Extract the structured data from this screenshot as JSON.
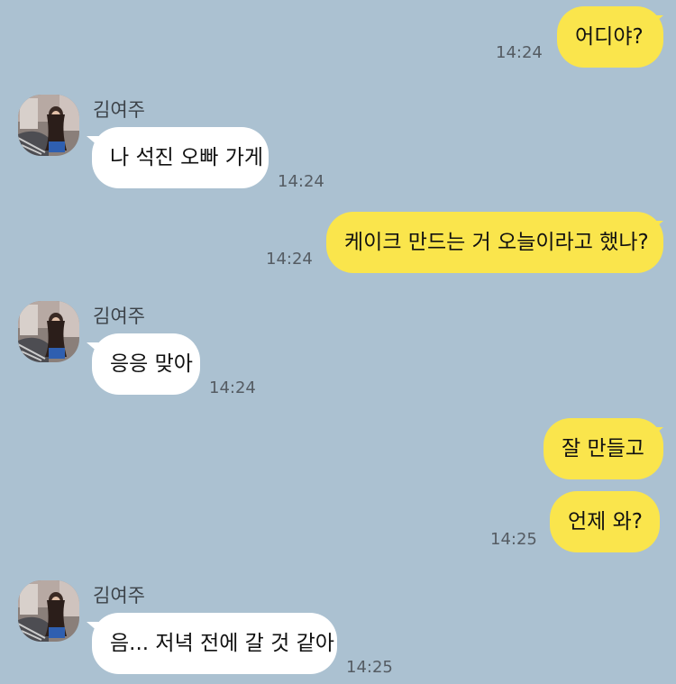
{
  "colors": {
    "background": "#abc1d1",
    "my_bubble": "#fae54c",
    "their_bubble": "#ffffff",
    "timestamp": "#555c63"
  },
  "contact": {
    "name": "김여주",
    "avatar_icon": "profile-photo"
  },
  "messages": [
    {
      "from": "me",
      "text": "어디야?",
      "time": "14:24"
    },
    {
      "from": "them",
      "sender": "김여주",
      "text": "나 석진 오빠 가게",
      "time": "14:24"
    },
    {
      "from": "me",
      "text": "케이크 만드는 거 오늘이라고 했나?",
      "time": "14:24"
    },
    {
      "from": "them",
      "sender": "김여주",
      "text": "응응 맞아",
      "time": "14:24"
    },
    {
      "from": "me",
      "text": "잘 만들고",
      "time": ""
    },
    {
      "from": "me",
      "text": "언제 와?",
      "time": "14:25"
    },
    {
      "from": "them",
      "sender": "김여주",
      "text": "음... 저녁 전에 갈 것 같아",
      "time": "14:25"
    }
  ]
}
